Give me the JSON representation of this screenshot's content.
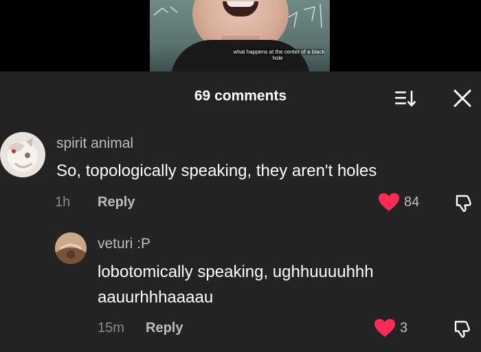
{
  "video": {
    "caption": "what happens at the center of a black hole"
  },
  "header": {
    "comment_count": "69 comments",
    "sort_icon": "sort-icon",
    "close_icon": "close-icon"
  },
  "comments": [
    {
      "username": "spirit animal",
      "text": "So, topologically speaking, they aren't holes",
      "time": "1h",
      "reply_label": "Reply",
      "likes": "84",
      "liked": true
    }
  ],
  "replies": [
    {
      "username": "veturi :P",
      "text_line1": "lobotomically speaking, ughhuuuuhhh",
      "text_line2": "aauurhhhaaaau",
      "time": "15m",
      "reply_label": "Reply",
      "likes": "3",
      "liked": true
    }
  ],
  "colors": {
    "panel_bg": "#232323",
    "heart": "#fe2c55"
  }
}
